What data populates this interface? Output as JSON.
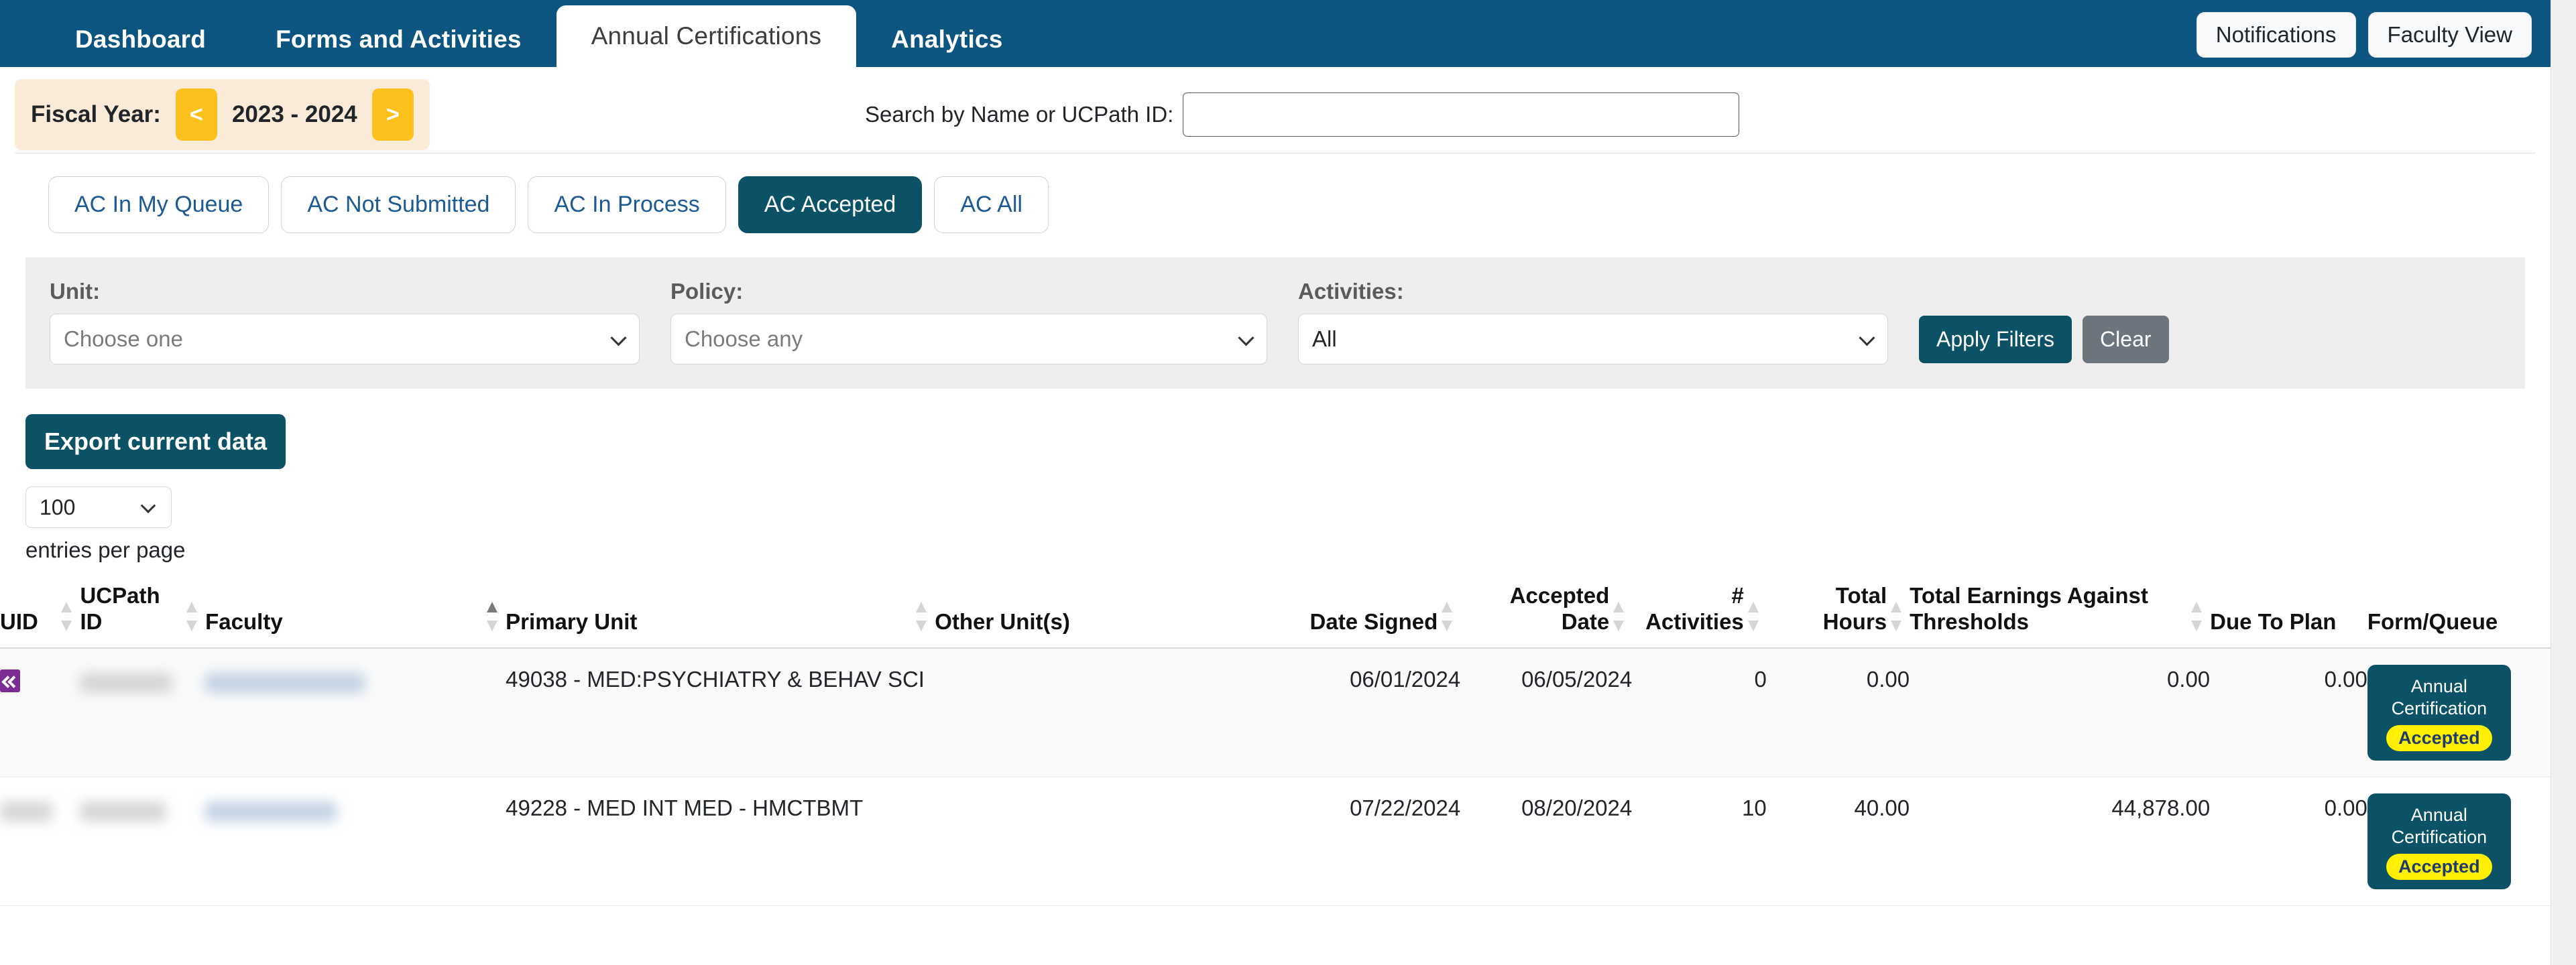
{
  "navbar": {
    "tabs": [
      {
        "label": "Dashboard",
        "active": false
      },
      {
        "label": "Forms and Activities",
        "active": false
      },
      {
        "label": "Annual Certifications",
        "active": true
      },
      {
        "label": "Analytics",
        "active": false
      }
    ],
    "notifications_label": "Notifications",
    "faculty_view_label": "Faculty View",
    "bar_color": "#0b5580"
  },
  "toolbar": {
    "fiscal_label": "Fiscal Year:",
    "fiscal_prev": "<",
    "fiscal_next": ">",
    "fiscal_value": "2023 - 2024",
    "fiscal_bg": "#faebd9",
    "fiscal_btn_color": "#fcc11c",
    "search_label": "Search by Name or UCPath ID:",
    "search_value": "",
    "search_placeholder": ""
  },
  "pills": [
    {
      "label": "AC In My Queue",
      "active": false
    },
    {
      "label": "AC Not Submitted",
      "active": false
    },
    {
      "label": "AC In Process",
      "active": false
    },
    {
      "label": "AC Accepted",
      "active": true
    },
    {
      "label": "AC All",
      "active": false
    }
  ],
  "filters": {
    "unit_label": "Unit:",
    "unit_value": "Choose one",
    "policy_label": "Policy:",
    "policy_value": "Choose any",
    "activities_label": "Activities:",
    "activities_value": "All",
    "apply_label": "Apply Filters",
    "clear_label": "Clear",
    "panel_bg": "#eeeeee",
    "accent": "#0b5266"
  },
  "export": {
    "button_label": "Export current data",
    "entries_value": "100",
    "entries_text": "entries per page"
  },
  "table": {
    "columns": [
      {
        "label": "UID",
        "sortable": true,
        "sort": "none",
        "align": "left"
      },
      {
        "label": "UCPath ID",
        "sortable": true,
        "sort": "none",
        "align": "left"
      },
      {
        "label": "Faculty",
        "sortable": true,
        "sort": "asc",
        "align": "left"
      },
      {
        "label": "Primary Unit",
        "sortable": true,
        "sort": "none",
        "align": "left"
      },
      {
        "label": "Other Unit(s)",
        "sortable": false,
        "sort": "none",
        "align": "left"
      },
      {
        "label": "Date Signed",
        "sortable": true,
        "sort": "none",
        "align": "right"
      },
      {
        "label": "Accepted Date",
        "sortable": true,
        "sort": "none",
        "align": "right"
      },
      {
        "label": "# Activities",
        "sortable": true,
        "sort": "none",
        "align": "right"
      },
      {
        "label": "Total Hours",
        "sortable": true,
        "sort": "none",
        "align": "right"
      },
      {
        "label": "Total Earnings Against Thresholds",
        "sortable": true,
        "sort": "none",
        "align": "right"
      },
      {
        "label": "Due To Plan",
        "sortable": false,
        "sort": "none",
        "align": "right"
      },
      {
        "label": "Form/Queue",
        "sortable": false,
        "sort": "none",
        "align": "left"
      }
    ],
    "rows": [
      {
        "uid_icon": "bookmark-chevron-icon",
        "uid": "",
        "uid_redacted": true,
        "ucpath_id": "",
        "ucpath_redacted": true,
        "faculty": "",
        "faculty_redacted": true,
        "primary_unit": "49038 - MED:PSYCHIATRY & BEHAV SCI",
        "other_units": "",
        "date_signed": "06/01/2024",
        "accepted_date": "06/05/2024",
        "num_activities": "0",
        "total_hours": "0.00",
        "total_earnings": "0.00",
        "due_to_plan": "0.00",
        "queue_title": "Annual Certification",
        "queue_status": "Accepted"
      },
      {
        "uid_icon": "",
        "uid": "",
        "uid_redacted": true,
        "ucpath_id": "",
        "ucpath_redacted": true,
        "faculty": "",
        "faculty_redacted": true,
        "primary_unit": "49228 - MED INT MED - HMCTBMT",
        "other_units": "",
        "date_signed": "07/22/2024",
        "accepted_date": "08/20/2024",
        "num_activities": "10",
        "total_hours": "40.00",
        "total_earnings": "44,878.00",
        "due_to_plan": "0.00",
        "queue_title": "Annual Certification",
        "queue_status": "Accepted"
      }
    ]
  }
}
